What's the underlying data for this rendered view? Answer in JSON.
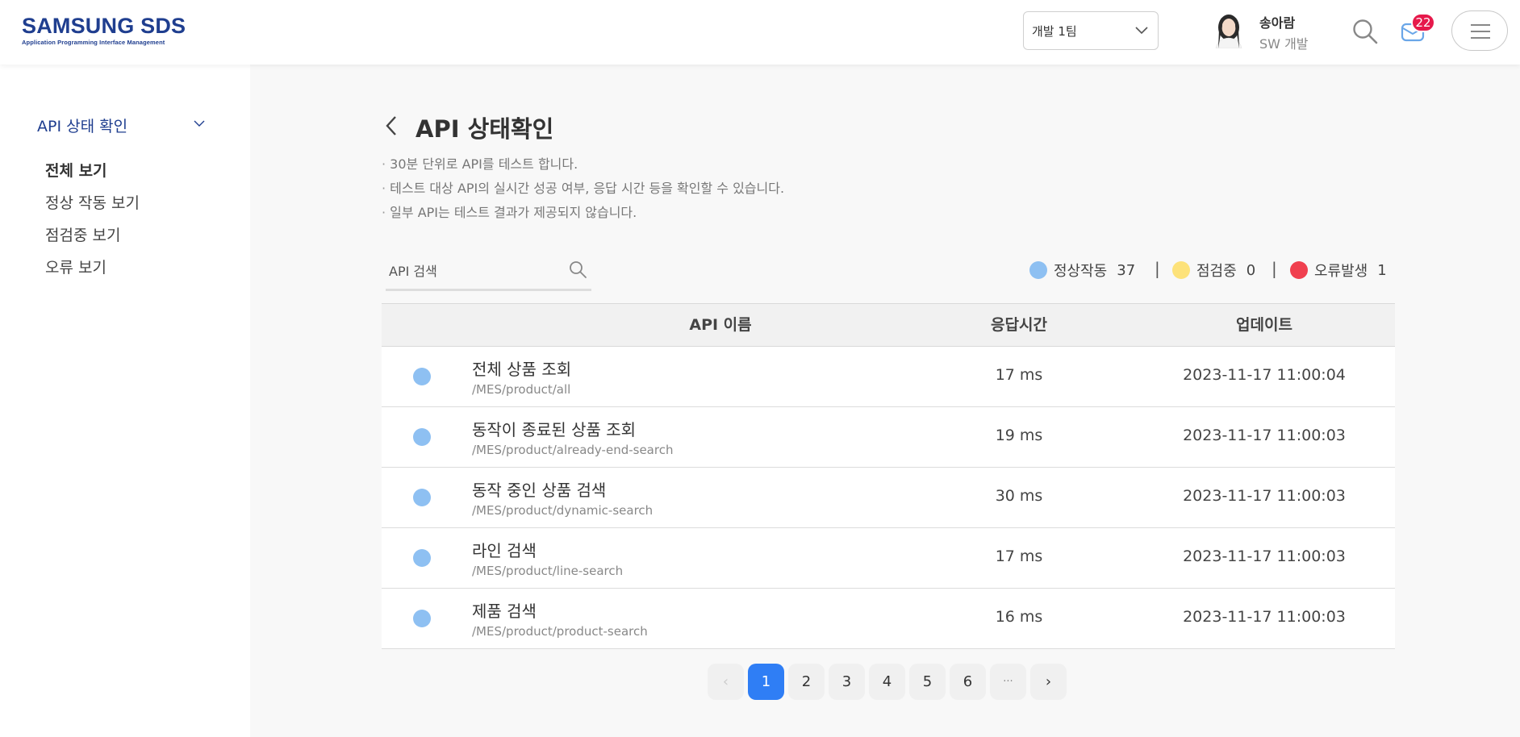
{
  "header": {
    "logo_main": "SAMSUNG SDS",
    "logo_sub": "Application Programming Interface Management",
    "team_select_value": "개발 1팀",
    "user_name": "송아람",
    "user_dept": "SW 개발",
    "notification_count": "22"
  },
  "sidebar": {
    "section_title": "API 상태 확인",
    "items": [
      {
        "label": "전체 보기",
        "active": true
      },
      {
        "label": "정상 작동 보기"
      },
      {
        "label": "점검중 보기"
      },
      {
        "label": "오류 보기"
      }
    ]
  },
  "main": {
    "title": "API 상태확인",
    "descriptions": [
      "30분 단위로 API를 테스트 합니다.",
      "테스트 대상 API의 실시간 성공 여부, 응답 시간 등을 확인할 수 있습니다.",
      "일부 API는 테스트 결과가 제공되지 않습니다."
    ],
    "search_placeholder": "API 검색",
    "legend": [
      {
        "label": "정상작동",
        "count": "37",
        "color": "#8ec0f2"
      },
      {
        "label": "점검중",
        "count": "0",
        "color": "#fde27a"
      },
      {
        "label": "오류발생",
        "count": "1",
        "color": "#f0404f"
      }
    ],
    "table": {
      "headers": [
        "API 이름",
        "응답시간",
        "업데이트"
      ],
      "rows": [
        {
          "name": "전체 상품 조회",
          "path": "/MES/product/all",
          "response": "17 ms",
          "updated": "2023-11-17 11:00:04",
          "status_color": "#8ec0f2"
        },
        {
          "name": "동작이 종료된 상품 조회",
          "path": "/MES/product/already-end-search",
          "response": "19 ms",
          "updated": "2023-11-17 11:00:03",
          "status_color": "#8ec0f2"
        },
        {
          "name": "동작 중인 상품 검색",
          "path": "/MES/product/dynamic-search",
          "response": "30 ms",
          "updated": "2023-11-17 11:00:03",
          "status_color": "#8ec0f2"
        },
        {
          "name": "라인 검색",
          "path": "/MES/product/line-search",
          "response": "17 ms",
          "updated": "2023-11-17 11:00:03",
          "status_color": "#8ec0f2"
        },
        {
          "name": "제품 검색",
          "path": "/MES/product/product-search",
          "response": "16 ms",
          "updated": "2023-11-17 11:00:03",
          "status_color": "#8ec0f2"
        }
      ]
    },
    "pagination": {
      "prev": "‹",
      "pages": [
        "1",
        "2",
        "3",
        "4",
        "5",
        "6"
      ],
      "ellipsis": "···",
      "next": "›",
      "current": "1"
    }
  },
  "icons": {
    "back": "chevron-left-icon",
    "search": "search-icon",
    "mail": "mail-icon",
    "menu": "hamburger-menu-icon"
  }
}
